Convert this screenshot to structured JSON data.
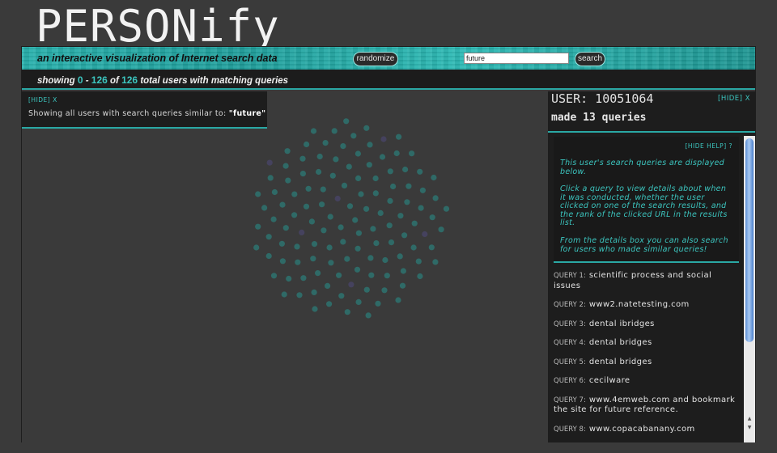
{
  "app": {
    "title": "PERSONify"
  },
  "banner": {
    "tagline": "an interactive visualization of Internet search data",
    "randomize_label": "randomize",
    "search_value": "future",
    "search_label": "search"
  },
  "showing": {
    "prefix": "showing",
    "range_start": "0",
    "dash": "-",
    "range_end": "126",
    "of": "of",
    "total": "126",
    "suffix": "total users with matching queries"
  },
  "info": {
    "hide_label": "[HIDE] X",
    "text": "Showing all users with search queries similar to:",
    "query": "\"future\""
  },
  "user": {
    "label": "USER: 10051064",
    "hide_label": "[HIDE] X",
    "made_queries": "made 13 queries"
  },
  "help": {
    "hide_label": "[HIDE HELP] ?",
    "p1": "This user's search queries are displayed below.",
    "p2": "Click a query to view details about when it was conducted, whether the user clicked on one of the search results, and the rank of the clicked URL in the results list.",
    "p3": "From the details box you can also search for users who made similar queries!"
  },
  "queries": [
    {
      "label": "QUERY 1:",
      "text": "scientific process and social issues"
    },
    {
      "label": "QUERY 2:",
      "text": "www2.natetesting.com"
    },
    {
      "label": "QUERY 3:",
      "text": "dental ibridges"
    },
    {
      "label": "QUERY 4:",
      "text": "dental bridges"
    },
    {
      "label": "QUERY 5:",
      "text": "dental bridges"
    },
    {
      "label": "QUERY 6:",
      "text": "cecilware"
    },
    {
      "label": "QUERY 7:",
      "text": "www.4emweb.com and bookmark the site for future reference."
    },
    {
      "label": "QUERY 8:",
      "text": "www.copacabanany.com"
    }
  ],
  "colors": {
    "accent": "#2aa8a4",
    "dot": "#2f6a67",
    "dot_alt": "#45425e"
  },
  "user_dots": {
    "count": 126
  }
}
